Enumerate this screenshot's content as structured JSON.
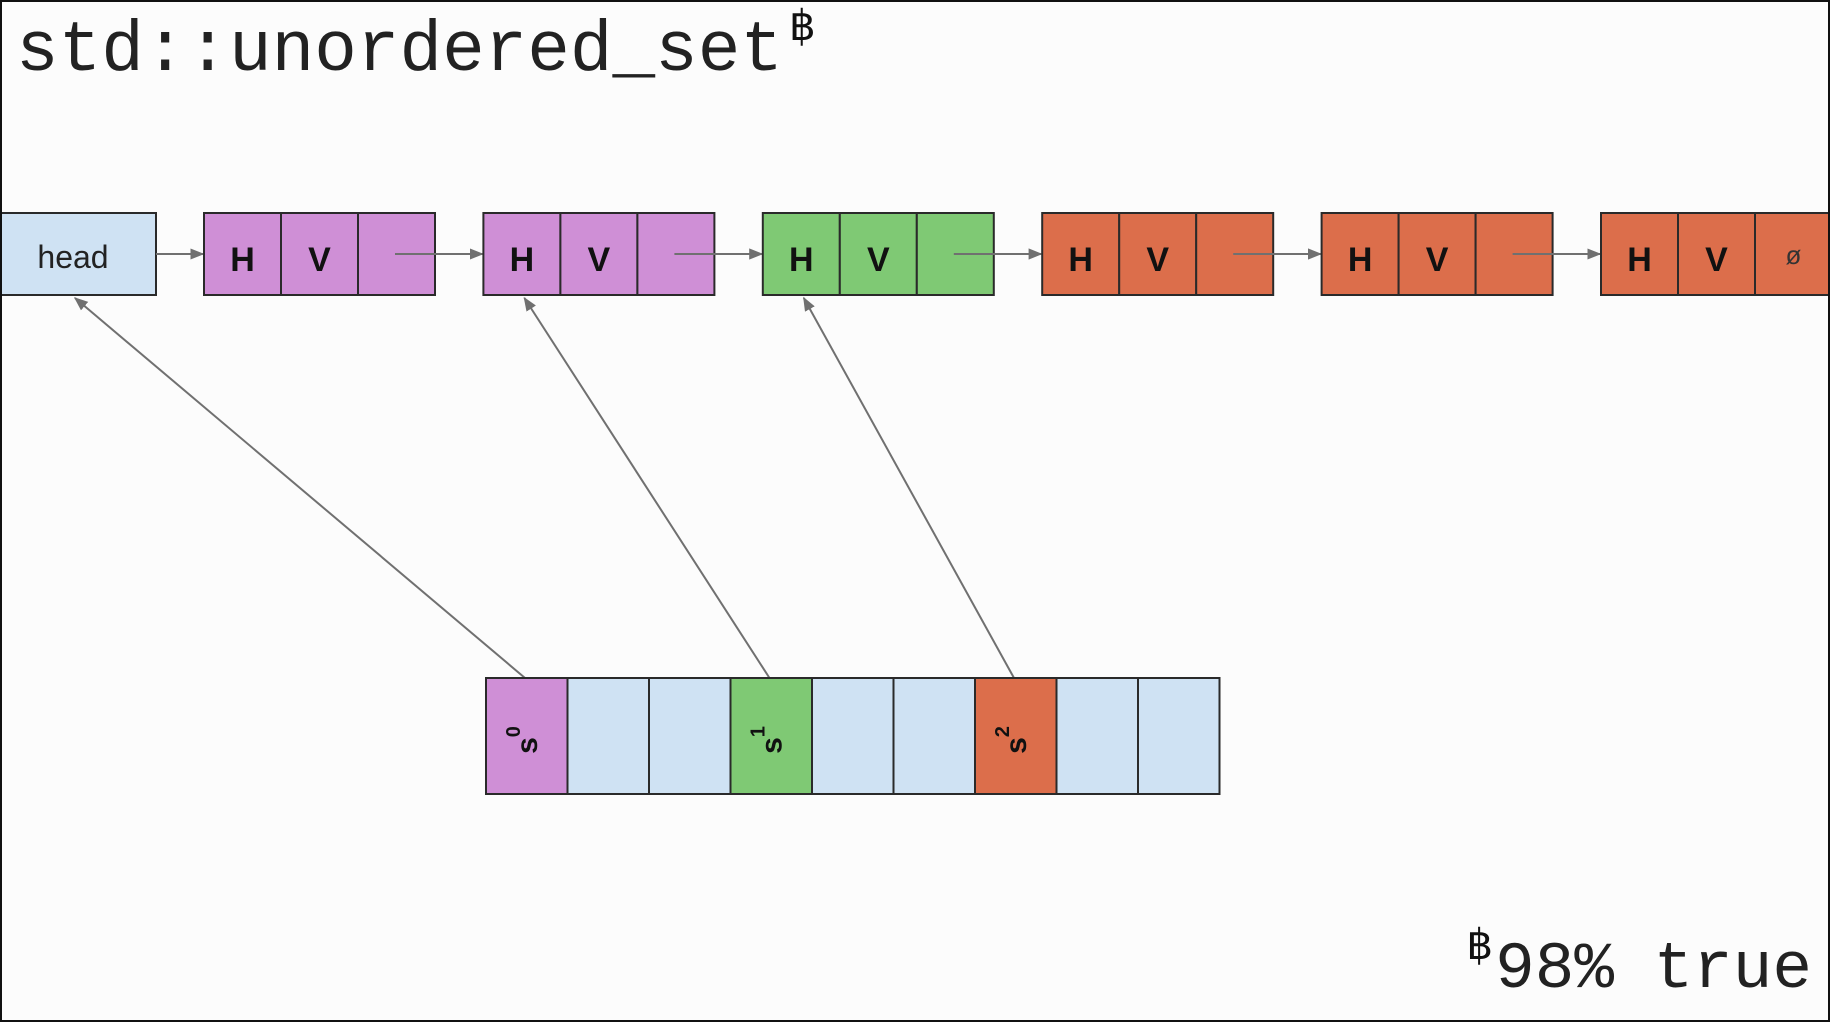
{
  "title": {
    "text": "std::unordered_set",
    "footnote_marker": "฿"
  },
  "footnote": {
    "marker": "฿",
    "text": "98% true"
  },
  "colors": {
    "purple": "#cf8fd6",
    "green": "#7fc974",
    "orange": "#dc6e4b",
    "light_blue": "#cfe2f3",
    "outline": "#2a2a2a",
    "arrow": "#707070"
  },
  "list": {
    "head_label": "head",
    "nodes": [
      {
        "color": "purple",
        "cells": [
          "H",
          "V",
          ""
        ],
        "next": true
      },
      {
        "color": "purple",
        "cells": [
          "H",
          "V",
          ""
        ],
        "next": true
      },
      {
        "color": "green",
        "cells": [
          "H",
          "V",
          ""
        ],
        "next": true
      },
      {
        "color": "orange",
        "cells": [
          "H",
          "V",
          ""
        ],
        "next": true
      },
      {
        "color": "orange",
        "cells": [
          "H",
          "V",
          ""
        ],
        "next": true
      },
      {
        "color": "orange",
        "cells": [
          "H",
          "V",
          "ø"
        ],
        "next": false
      }
    ]
  },
  "buckets": {
    "cells": [
      {
        "color": "purple",
        "label": "s",
        "index": "0",
        "points_to": "head"
      },
      {
        "color": "light_blue",
        "label": "",
        "index": ""
      },
      {
        "color": "light_blue",
        "label": "",
        "index": ""
      },
      {
        "color": "green",
        "label": "s",
        "index": "1",
        "points_to": "node-1"
      },
      {
        "color": "light_blue",
        "label": "",
        "index": ""
      },
      {
        "color": "light_blue",
        "label": "",
        "index": ""
      },
      {
        "color": "orange",
        "label": "s",
        "index": "2",
        "points_to": "node-2"
      },
      {
        "color": "light_blue",
        "label": "",
        "index": ""
      },
      {
        "color": "light_blue",
        "label": "",
        "index": ""
      }
    ]
  }
}
